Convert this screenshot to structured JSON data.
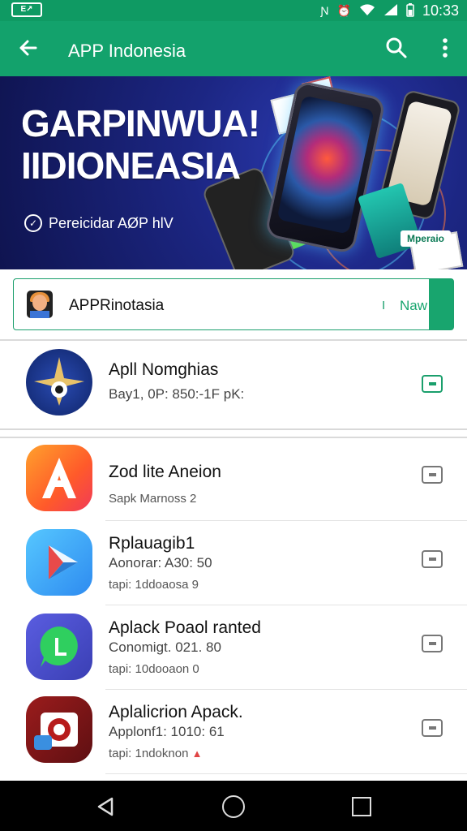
{
  "status_bar": {
    "left_icon": "notification-badge-icon",
    "left_label": "E↗",
    "icons": [
      "nfc-icon",
      "alarm-icon",
      "wifi-icon",
      "signal-icon",
      "battery-icon"
    ],
    "time": "10:33"
  },
  "app_bar": {
    "title": "APP Indonesia",
    "back_icon": "arrow-left-icon",
    "search_icon": "search-icon",
    "more_icon": "more-vert-icon"
  },
  "banner": {
    "headline_1": "GARPINWUA!",
    "headline_2": "IIDIONEASIA",
    "subtitle": "Pereicidar AØP hlV",
    "badge": "Mperaio"
  },
  "featured": {
    "label": "APPRinotasia",
    "separator": "I",
    "action": "Naw"
  },
  "apps": [
    {
      "name": "Apll Nomghias",
      "meta": "Bay1, 0P: 850:-1F pK:",
      "meta2": "",
      "icon": "star-target-icon",
      "action_icon": "install-icon"
    },
    {
      "name": "Zod lite Aneion",
      "meta": "",
      "meta2": "Sapk Marnoss 2",
      "icon": "letter-a-icon",
      "action_icon": "install-icon"
    },
    {
      "name": "Rplauagib1",
      "meta": "Aonorar: A30: 50",
      "meta2": "tapi: 1ddoaosa 9",
      "icon": "play-arrow-icon",
      "action_icon": "install-icon"
    },
    {
      "name": "Aplack Poaol ranted",
      "meta": "Conomigt. 021. 80",
      "meta2": "tapi: 10dooaon 0",
      "icon": "chat-bubble-icon",
      "action_icon": "install-icon"
    },
    {
      "name": "Aplalicrion Apack.",
      "meta": "Applonf1: 1010: 61",
      "meta2": "tapi: 1ndoknon",
      "icon": "camera-icon",
      "action_icon": "install-icon"
    }
  ],
  "nav": {
    "back": "nav-back-icon",
    "home": "nav-home-icon",
    "recents": "nav-recents-icon"
  },
  "colors": {
    "primary": "#13a26c",
    "status_bar": "#0f9a63",
    "accent": "#18a56e",
    "banner_bg": "#1c2683"
  }
}
